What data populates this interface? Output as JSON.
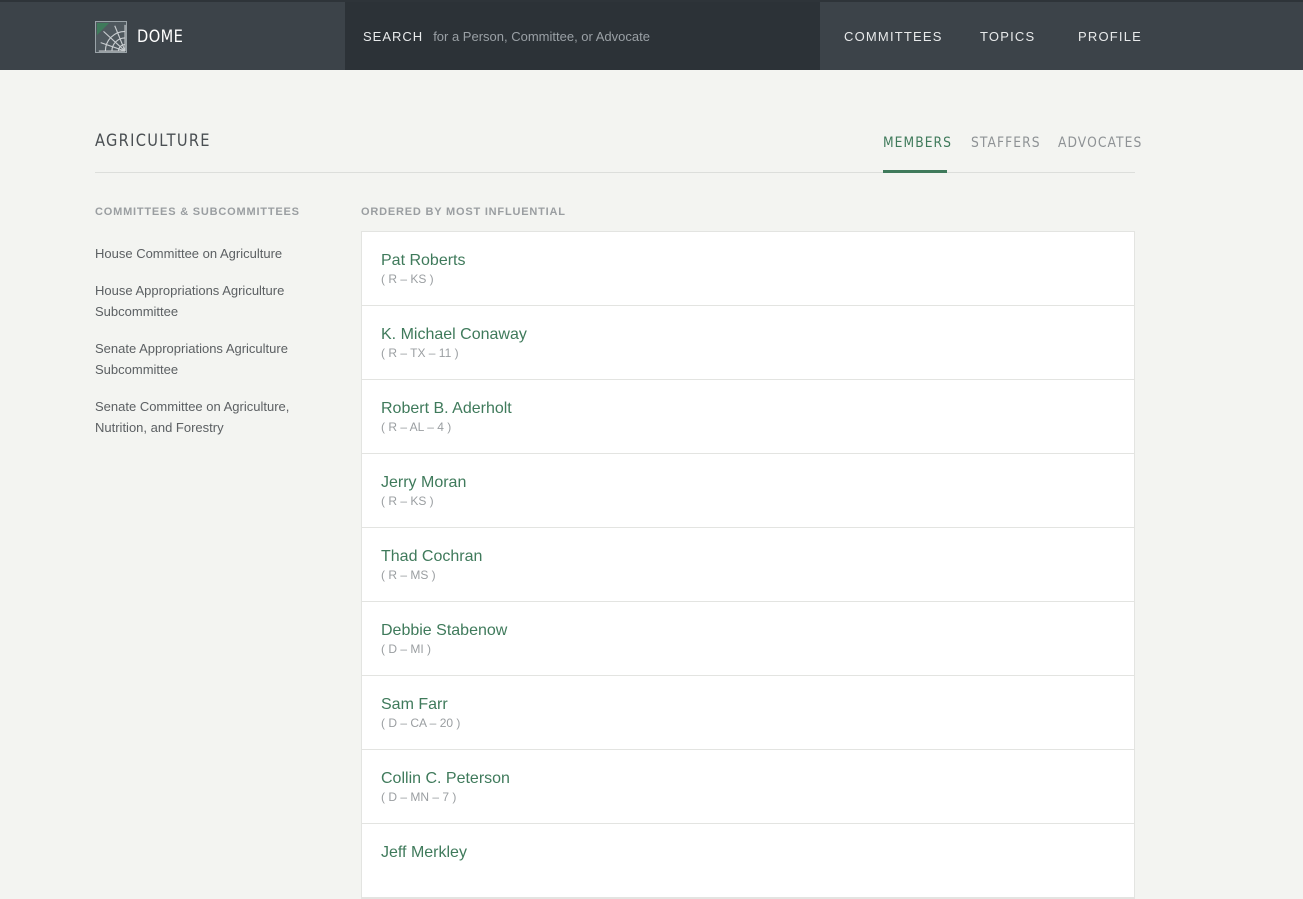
{
  "header": {
    "brand": "DOME",
    "search_label": "SEARCH",
    "search_placeholder": "for a Person, Committee, or Advocate",
    "nav": [
      "COMMITTEES",
      "TOPICS",
      "PROFILE"
    ]
  },
  "page": {
    "title": "AGRICULTURE",
    "tabs": [
      "MEMBERS",
      "STAFFERS",
      "ADVOCATES"
    ],
    "active_tab": "MEMBERS"
  },
  "sidebar": {
    "heading": "COMMITTEES & SUBCOMMITTEES",
    "items": [
      "House Committee on Agriculture",
      "House Appropriations Agriculture Subcommittee",
      "Senate Appropriations Agriculture Subcommittee",
      "Senate Committee on Agriculture, Nutrition, and Forestry"
    ]
  },
  "members": {
    "heading": "ORDERED BY MOST INFLUENTIAL",
    "list": [
      {
        "name": "Pat Roberts",
        "party": "( R – KS )"
      },
      {
        "name": "K. Michael Conaway",
        "party": "( R – TX – 11 )"
      },
      {
        "name": "Robert B. Aderholt",
        "party": "( R – AL – 4 )"
      },
      {
        "name": "Jerry Moran",
        "party": "( R – KS )"
      },
      {
        "name": "Thad Cochran",
        "party": "( R – MS )"
      },
      {
        "name": "Debbie Stabenow",
        "party": "( D – MI )"
      },
      {
        "name": "Sam Farr",
        "party": "( D – CA – 20 )"
      },
      {
        "name": "Collin C. Peterson",
        "party": "( D – MN – 7 )"
      },
      {
        "name": "Jeff Merkley",
        "party": ""
      }
    ]
  },
  "colors": {
    "header_bg": "#3c4349",
    "search_bg": "#2c3237",
    "accent": "#3f7a5b",
    "page_bg": "#f3f4f1"
  }
}
